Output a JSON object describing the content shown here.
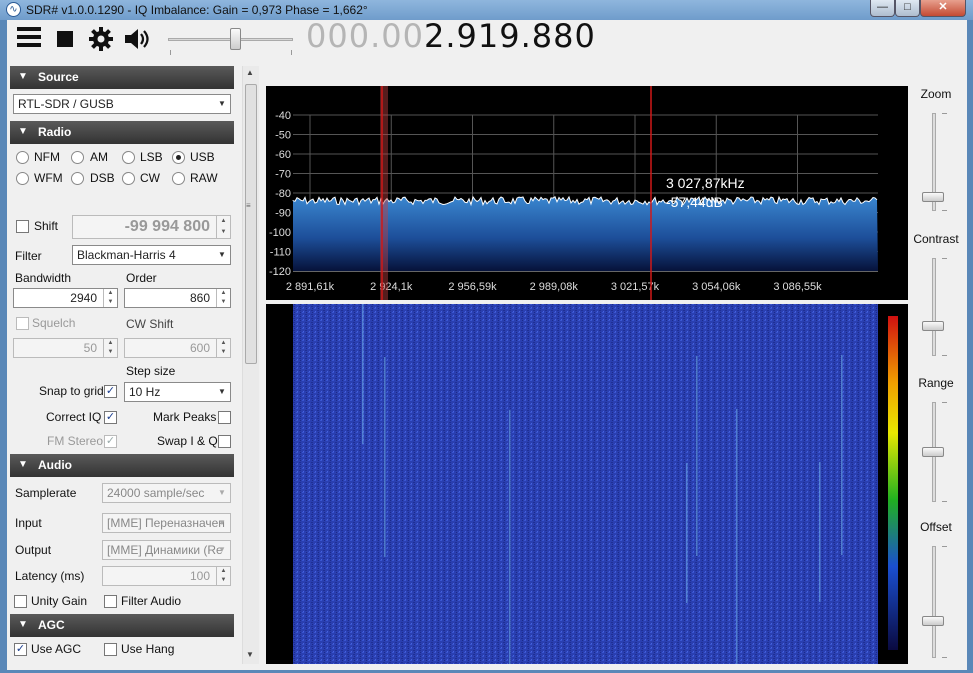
{
  "window": {
    "title": "SDR# v1.0.0.1290 - IQ Imbalance: Gain = 0,973 Phase = 1,662°",
    "app_icon": "sdr-logo-icon",
    "minimize": "—",
    "maximize": "□",
    "close": "✕"
  },
  "toolbar": {
    "frequency_dim": "000.00",
    "frequency_main": "2.919.880",
    "volume_level": 0.55
  },
  "source": {
    "header": "Source",
    "device": "RTL-SDR / GUSB"
  },
  "radio": {
    "header": "Radio",
    "modes": [
      {
        "label": "NFM",
        "selected": false
      },
      {
        "label": "AM",
        "selected": false
      },
      {
        "label": "LSB",
        "selected": false
      },
      {
        "label": "USB",
        "selected": true
      },
      {
        "label": "WFM",
        "selected": false
      },
      {
        "label": "DSB",
        "selected": false
      },
      {
        "label": "CW",
        "selected": false
      },
      {
        "label": "RAW",
        "selected": false
      }
    ],
    "shift_label": "Shift",
    "shift_value": "-99 994 800",
    "filter_label": "Filter",
    "filter_value": "Blackman-Harris 4",
    "bandwidth_label": "Bandwidth",
    "bandwidth_value": "2940",
    "order_label": "Order",
    "order_value": "860",
    "squelch_label": "Squelch",
    "squelch_value": "50",
    "cwshift_label": "CW Shift",
    "cwshift_value": "600",
    "stepsize_label": "Step size",
    "snap_label": "Snap to grid",
    "stepsize_value": "10 Hz",
    "correctiq_label": "Correct IQ",
    "markpeaks_label": "Mark Peaks",
    "fmstereo_label": "FM Stereo",
    "swapiq_label": "Swap I & Q"
  },
  "audio": {
    "header": "Audio",
    "samplerate_label": "Samplerate",
    "samplerate_value": "24000 sample/sec",
    "input_label": "Input",
    "input_value": "[MME] Переназначен",
    "output_label": "Output",
    "output_value": "[MME] Динамики (Re",
    "latency_label": "Latency (ms)",
    "latency_value": "100",
    "unitygain_label": "Unity Gain",
    "filteraudio_label": "Filter Audio"
  },
  "agc": {
    "header": "AGC",
    "useagc_label": "Use AGC",
    "usehang_label": "Use Hang"
  },
  "spectrum": {
    "y_ticks": [
      "-40",
      "-50",
      "-60",
      "-70",
      "-80",
      "-90",
      "-100",
      "-110",
      "-120"
    ],
    "x_ticks": [
      "2 891,61k",
      "2 924,1k",
      "2 956,59k",
      "2 989,08k",
      "3 021,57k",
      "3 054,06k",
      "3 086,55k"
    ],
    "cursor_freq": "3 027,87kHz",
    "cursor_db": "-57,44dB",
    "noise_floor_db": -84
  },
  "controls": {
    "zoom_label": "Zoom",
    "contrast_label": "Contrast",
    "range_label": "Range",
    "offset_label": "Offset"
  },
  "colors": {
    "spectrum_fill": "#2f6db5",
    "waterfall_bg": "#2a3fb0",
    "marker": "#d01818",
    "header_bg": "#3d3d3d"
  }
}
